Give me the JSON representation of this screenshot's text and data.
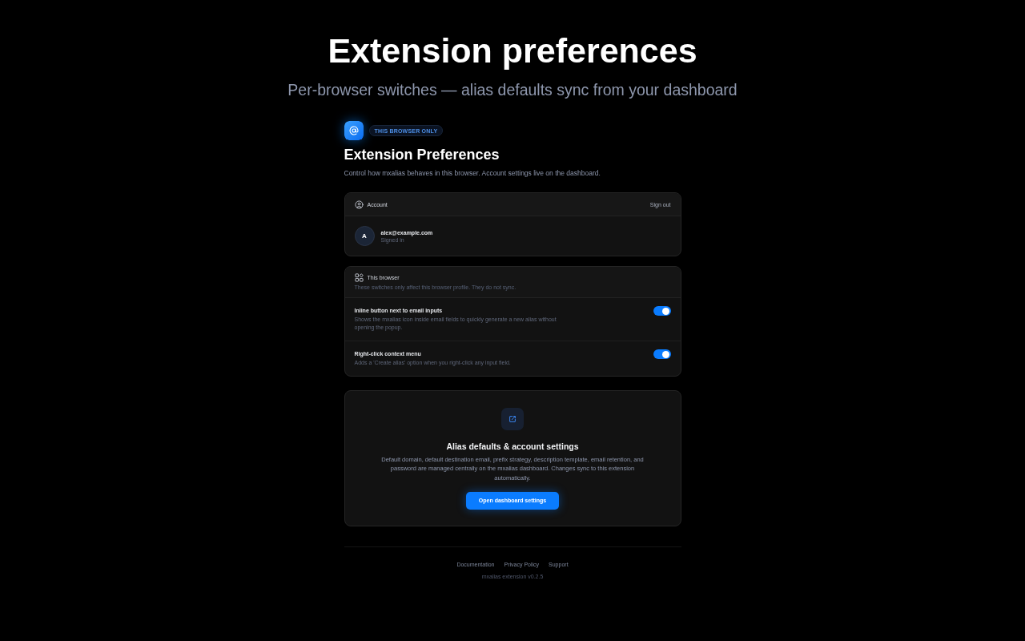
{
  "page_header": {
    "title": "Extension preferences",
    "subtitle": "Per-browser switches — alias defaults sync from your dashboard"
  },
  "header": {
    "badge": "THIS BROWSER ONLY",
    "title": "Extension Preferences",
    "description": "Control how mxalias behaves in this browser. Account settings live on the dashboard."
  },
  "account_card": {
    "title": "Account",
    "sign_out": "Sign out",
    "avatar_initial": "A",
    "email": "alex@example.com",
    "status": "Signed in"
  },
  "browser_card": {
    "title": "This browser",
    "subtitle": "These switches only affect this browser profile. They do not sync.",
    "settings": [
      {
        "label": "Inline button next to email inputs",
        "description": "Shows the mxalias icon inside email fields to quickly generate a new alias without opening the popup.",
        "on": true
      },
      {
        "label": "Right-click context menu",
        "description": "Adds a 'Create alias' option when you right-click any input field.",
        "on": true
      }
    ]
  },
  "dashboard_card": {
    "title": "Alias defaults & account settings",
    "description": "Default domain, default destination email, prefix strategy, description template, email retention, and password are managed centrally on the mxalias dashboard. Changes sync to this extension automatically.",
    "button": "Open dashboard settings"
  },
  "footer": {
    "links": [
      "Documentation",
      "Privacy Policy",
      "Support"
    ],
    "version": "mxalias extension v0.2.5"
  }
}
